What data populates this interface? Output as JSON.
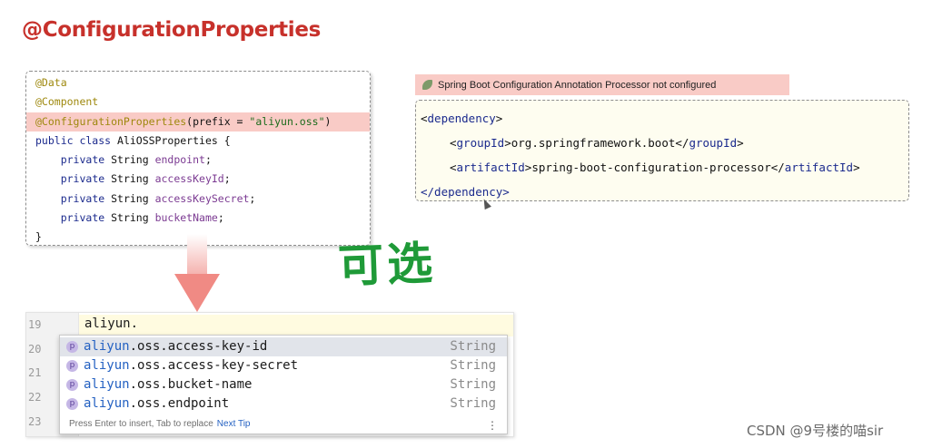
{
  "title": "@ConfigurationProperties",
  "java_code": {
    "line1": "@Data",
    "line2": "@Component",
    "line3_anno": "@ConfigurationProperties",
    "line3_args": "(prefix = ",
    "line3_str": "\"aliyun.oss\"",
    "line3_end": ")",
    "line4_kw": "public class ",
    "line4_name": "AliOSSProperties {",
    "fields": [
      {
        "mod": "private ",
        "type": "String ",
        "name": "endpoint",
        "end": ";"
      },
      {
        "mod": "private ",
        "type": "String ",
        "name": "accessKeyId",
        "end": ";"
      },
      {
        "mod": "private ",
        "type": "String ",
        "name": "accessKeySecret",
        "end": ";"
      },
      {
        "mod": "private ",
        "type": "String ",
        "name": "bucketName",
        "end": ";"
      }
    ],
    "close": "}"
  },
  "optional_label": "可选",
  "warning": "Spring Boot Configuration Annotation Processor not configured",
  "xml": {
    "dep_open_lt": "<",
    "dep_tag": "dependency",
    "dep_open_gt": ">",
    "gid_tag": "groupId",
    "gid_value": "org.springframework.boot",
    "aid_tag": "artifactId",
    "aid_value": "spring-boot-configuration-processor",
    "dep_close": "</dependency>"
  },
  "editor": {
    "line_numbers": [
      "19",
      "20",
      "21",
      "22",
      "23"
    ],
    "typed_text": "aliyun.",
    "suggestions": [
      {
        "prefix": "aliyun",
        "rest": ".oss.access-key-id",
        "type": "String"
      },
      {
        "prefix": "aliyun",
        "rest": ".oss.access-key-secret",
        "type": "String"
      },
      {
        "prefix": "aliyun",
        "rest": ".oss.bucket-name",
        "type": "String"
      },
      {
        "prefix": "aliyun",
        "rest": ".oss.endpoint",
        "type": "String"
      }
    ],
    "icon_letter": "p",
    "footer_hint": "Press Enter to insert, Tab to replace",
    "footer_link": "Next Tip",
    "kebab_glyph": "⋮"
  },
  "watermark": "CSDN @9号楼的喵sir"
}
